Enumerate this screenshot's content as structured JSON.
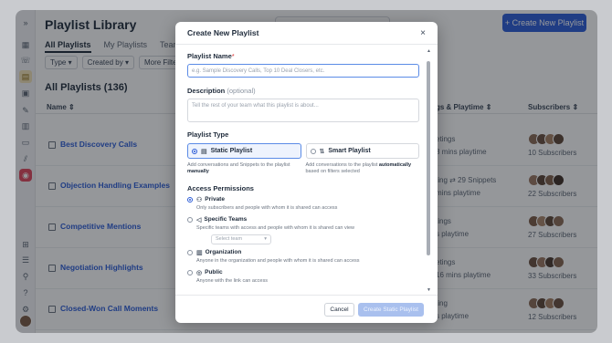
{
  "rail": {
    "icons": [
      "expand-icon",
      "calendar-icon",
      "phone-icon",
      "playlist-icon",
      "deals-icon",
      "notes-icon",
      "inbox-icon",
      "archive-icon",
      "analytics-icon",
      "record-icon",
      "grid-icon",
      "list-icon",
      "pin-icon",
      "help-icon",
      "settings-icon"
    ]
  },
  "page": {
    "title": "Playlist Library",
    "new_button": "+ Create New Playlist",
    "tabs": [
      "All Playlists",
      "My Playlists",
      "Teammate"
    ],
    "filters": [
      "Type ▾",
      "Created by ▾",
      "More Filters"
    ],
    "count_title": "All Playlists (136)",
    "col_name": "Name ⇕",
    "col_plays": "gs & Playtime ⇕",
    "col_subs": "Subscribers ⇕"
  },
  "rows": [
    {
      "name": "Best Discovery Calls",
      "c1": "etings",
      "c2": "8 mins playtime",
      "subs": "10 Subscribers"
    },
    {
      "name": "Objection Handling Examples",
      "c1": "ting   ⇄ 29 Snippets",
      "c2": "mins playtime",
      "subs": "22 Subscribers"
    },
    {
      "name": "Competitive Mentions",
      "c1": "tings",
      "c2": "s playtime",
      "subs": "27 Subscribers"
    },
    {
      "name": "Negotiation Highlights",
      "c1": "etings",
      "c2": "16 mins playtime",
      "subs": "33 Subscribers"
    },
    {
      "name": "Closed-Won Call Moments",
      "c1": "ting",
      "c2": "s playtime",
      "subs": "12 Subscribers"
    }
  ],
  "modal": {
    "title": "Create New Playlist",
    "close": "×",
    "name_label": "Playlist Name",
    "name_req": "*",
    "name_placeholder": "e.g. Sample Discovery Calls, Top 10 Deal Closers, etc.",
    "desc_label": "Description",
    "desc_opt": "(optional)",
    "desc_placeholder": "Tell the rest of your team what this playlist is about...",
    "type_label": "Playlist Type",
    "static_label": "Static Playlist",
    "static_desc": "Add conversations and Snippets to the playlist",
    "static_desc_bold": "manually",
    "smart_label": "Smart Playlist",
    "smart_desc": "Add conversations to the playlist",
    "smart_desc_bold": "automatically",
    "smart_desc_tail": "based on filters selected",
    "access_label": "Access Permissions",
    "access": [
      {
        "title": "Private",
        "desc": "Only subscribers and people with whom it is shared can access",
        "on": true
      },
      {
        "title": "Specific Teams",
        "desc": "Specific teams with access and people with whom it is shared can view",
        "on": false
      },
      {
        "title": "Organization",
        "desc": "Anyone in the organization and people with whom it is shared can access",
        "on": false
      },
      {
        "title": "Public",
        "desc": "Anyone with the link can access",
        "on": false
      }
    ],
    "team_placeholder": "Select team",
    "cancel": "Cancel",
    "create": "Create Static Playlist"
  }
}
